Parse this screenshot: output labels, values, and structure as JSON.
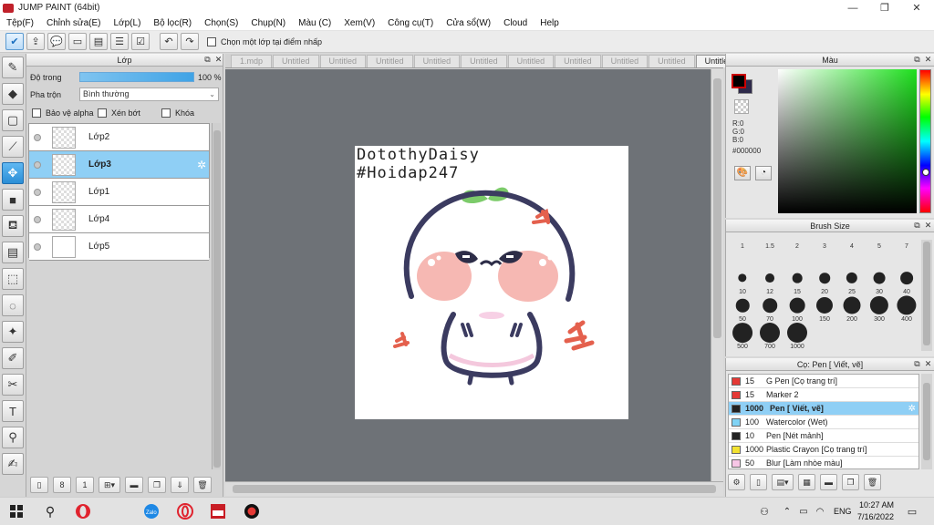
{
  "window": {
    "title": "JUMP PAINT (64bit)",
    "minimize_icon": "minimize-icon",
    "maximize_icon": "restore-icon",
    "close_icon": "close-icon"
  },
  "menu": [
    "Tệp(F)",
    "Chỉnh sửa(E)",
    "Lớp(L)",
    "Bộ lọc(R)",
    "Chọn(S)",
    "Chụp(N)",
    "Màu (C)",
    "Xem(V)",
    "Công cụ(T)",
    "Cửa sổ(W)",
    "Cloud",
    "Help"
  ],
  "toolbar": {
    "sample_one_layer_label": "Chọn một lớp tại điểm nhấp"
  },
  "tools": [
    {
      "name": "pen-tool",
      "glyph": "✎"
    },
    {
      "name": "eraser-tool",
      "glyph": "◆"
    },
    {
      "name": "rectangle-tool",
      "glyph": "▢"
    },
    {
      "name": "line-tool",
      "glyph": "⟋"
    },
    {
      "name": "move-tool",
      "glyph": "✥"
    },
    {
      "name": "fill-rect-tool",
      "glyph": "■"
    },
    {
      "name": "bucket-tool",
      "glyph": "⛾"
    },
    {
      "name": "gradient-tool",
      "glyph": "▤"
    },
    {
      "name": "select-rect-tool",
      "glyph": "⬚"
    },
    {
      "name": "lasso-tool",
      "glyph": "◌"
    },
    {
      "name": "magic-wand-tool",
      "glyph": "✦"
    },
    {
      "name": "select-pen-tool",
      "glyph": "✐"
    },
    {
      "name": "select-eraser-tool",
      "glyph": "✂"
    },
    {
      "name": "text-tool",
      "glyph": "T"
    },
    {
      "name": "eyedropper-tool",
      "glyph": "⚲"
    },
    {
      "name": "hand-tool",
      "glyph": "✍"
    }
  ],
  "layer_panel": {
    "title": "Lớp",
    "opacity_label": "Độ trong",
    "opacity_value": "100 %",
    "opacity_fraction": 1.0,
    "blend_label": "Pha trộn",
    "blend_value": "Bình thường",
    "protect_alpha_label": "Bảo vệ alpha",
    "clipping_label": "Xén bớt",
    "lock_label": "Khóa",
    "layers": [
      {
        "name": "Lớp2",
        "selected": false
      },
      {
        "name": "Lớp3",
        "selected": true
      },
      {
        "name": "Lớp1",
        "selected": false
      },
      {
        "name": "Lớp4",
        "selected": false
      },
      {
        "name": "Lớp5",
        "selected": false
      }
    ]
  },
  "canvas": {
    "tabs": [
      "1.mdp",
      "Untitled",
      "Untitled",
      "Untitled",
      "Untitled",
      "Untitled",
      "Untitled",
      "Untitled",
      "Untitled",
      "Untitled",
      "Untitled"
    ],
    "active_tab_index": 10,
    "signature_line1": "DotothyDaisy",
    "signature_line2": "#Hoidap247"
  },
  "color_panel": {
    "title": "Màu",
    "r": "R:0",
    "g": "G:0",
    "b": "B:0",
    "hex": "#000000",
    "fg_color": "#000000",
    "bg_color": "#2e2a4a"
  },
  "brush_panel": {
    "title": "Brush Size",
    "sizes": [
      "1",
      "1.5",
      "2",
      "3",
      "4",
      "5",
      "7",
      "10",
      "12",
      "15",
      "20",
      "25",
      "30",
      "40",
      "50",
      "70",
      "100",
      "150",
      "200",
      "300",
      "400",
      "500",
      "700",
      "1000"
    ]
  },
  "tool_list_panel": {
    "title": "Cọ: Pen [ Viết, vẽ]",
    "items": [
      {
        "size": "15",
        "name": "G Pen [Cọ trang trí]",
        "color": "#e53935",
        "selected": false
      },
      {
        "size": "15",
        "name": "Marker 2",
        "color": "#e53935",
        "selected": false
      },
      {
        "size": "1000",
        "name": "Pen [ Viết, vẽ]",
        "color": "#222222",
        "selected": true
      },
      {
        "size": "100",
        "name": "Watercolor (Wet)",
        "color": "#7fd3f5",
        "selected": false
      },
      {
        "size": "10",
        "name": "Pen [Nét mảnh]",
        "color": "#222222",
        "selected": false
      },
      {
        "size": "1000",
        "name": "Plastic Crayon [Cọ trang trí]",
        "color": "#f2e230",
        "selected": false
      },
      {
        "size": "50",
        "name": "Blur [Làm nhòe màu]",
        "color": "#f7c6e6",
        "selected": false
      },
      {
        "size": "",
        "name": "",
        "color": "#ffffff",
        "selected": false
      }
    ]
  },
  "taskbar": {
    "language": "ENG",
    "time": "10:27 AM",
    "date": "7/16/2022"
  },
  "colors": {
    "accent": "#2b8ed6",
    "selection": "#8fcff5",
    "canvas_bg": "#6e7277"
  }
}
